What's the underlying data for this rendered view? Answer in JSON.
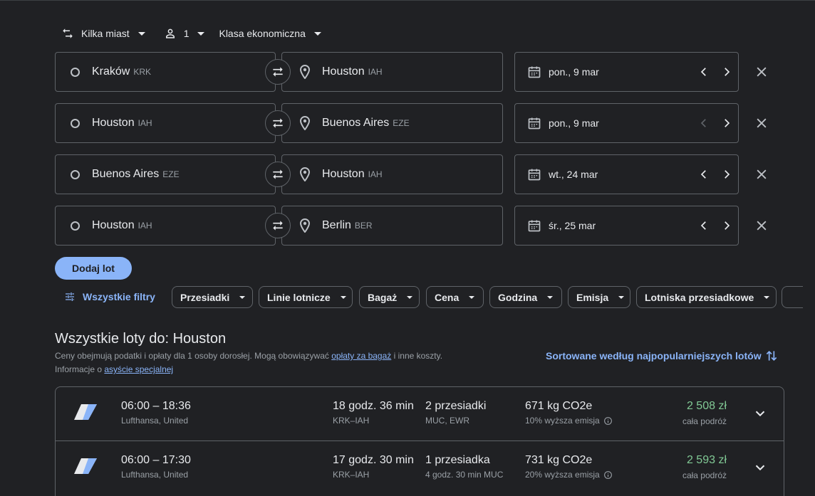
{
  "search": {
    "trip_type": "Kilka miast",
    "passengers": "1",
    "cabin_class": "Klasa ekonomiczna"
  },
  "legs": [
    {
      "origin_city": "Kraków",
      "origin_code": "KRK",
      "dest_city": "Houston",
      "dest_code": "IAH",
      "date": "pon., 9 mar",
      "prev_enabled": true
    },
    {
      "origin_city": "Houston",
      "origin_code": "IAH",
      "dest_city": "Buenos Aires",
      "dest_code": "EZE",
      "date": "pon., 9 mar",
      "prev_enabled": false
    },
    {
      "origin_city": "Buenos Aires",
      "origin_code": "EZE",
      "dest_city": "Houston",
      "dest_code": "IAH",
      "date": "wt., 24 mar",
      "prev_enabled": true
    },
    {
      "origin_city": "Houston",
      "origin_code": "IAH",
      "dest_city": "Berlin",
      "dest_code": "BER",
      "date": "śr., 25 mar",
      "prev_enabled": true
    }
  ],
  "add_flight_label": "Dodaj lot",
  "filters": {
    "all_label": "Wszystkie filtry",
    "chips": [
      "Przesiadki",
      "Linie lotnicze",
      "Bagaż",
      "Cena",
      "Godzina",
      "Emisja",
      "Lotniska przesiadkowe"
    ]
  },
  "results": {
    "title": "Wszystkie loty do: Houston",
    "note_part1": "Ceny obejmują podatki i opłaty dla 1 osoby dorosłej. Mogą obowiązywać ",
    "note_link1": "opłaty za bagaż",
    "note_part2": " i inne koszty.",
    "note_part3": "Informacje o ",
    "note_link2": "asyście specjalnej",
    "sort_label": "Sortowane według najpopularniejszych lotów",
    "flights": [
      {
        "times": "06:00 – 18:36",
        "airline": "Lufthansa, United",
        "duration": "18 godz. 36 min",
        "route": "KRK–IAH",
        "stops": "2 przesiadki",
        "stops_detail": "MUC, EWR",
        "co2": "671 kg CO2e",
        "emission": "10% wyższa emisja",
        "price": "2 508 zł",
        "price_note": "cała podróż"
      },
      {
        "times": "06:00 – 17:30",
        "airline": "Lufthansa, United",
        "duration": "17 godz. 30 min",
        "route": "KRK–IAH",
        "stops": "1 przesiadka",
        "stops_detail": "4 godz. 30 min MUC",
        "co2": "731 kg CO2e",
        "emission": "20% wyższa emisja",
        "price": "2 593 zł",
        "price_note": "cała podróż"
      }
    ]
  },
  "colors": {
    "background": "#202124",
    "accent": "#8ab4f8",
    "price_green": "#81c995",
    "border": "#5f6368"
  }
}
